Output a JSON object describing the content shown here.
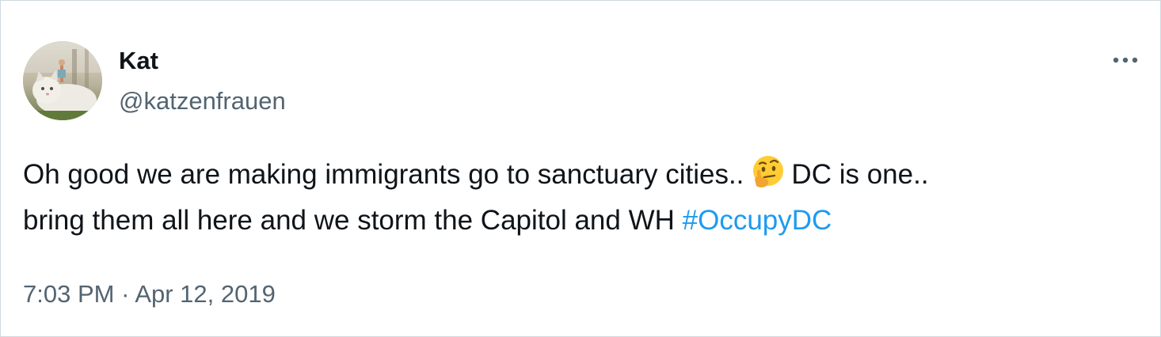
{
  "tweet": {
    "author": {
      "display_name": "Kat",
      "handle": "@katzenfrauen",
      "avatar_icon": "cat-photo-avatar"
    },
    "more_icon": "more-options-icon",
    "text": {
      "line1_before": "Oh good we are making immigrants go to sanctuary cities..",
      "emoji": "thinking-face-emoji",
      "line1_after": "DC is one..",
      "line2": "bring them all here and we storm the Capitol and WH",
      "hashtag": "#OccupyDC"
    },
    "timestamp": {
      "time": "7:03 PM",
      "separator": "·",
      "date": "Apr 12, 2019"
    },
    "colors": {
      "text": "#0f1419",
      "secondary": "#536471",
      "link": "#1d9bf0",
      "border": "#cfd9de"
    }
  }
}
